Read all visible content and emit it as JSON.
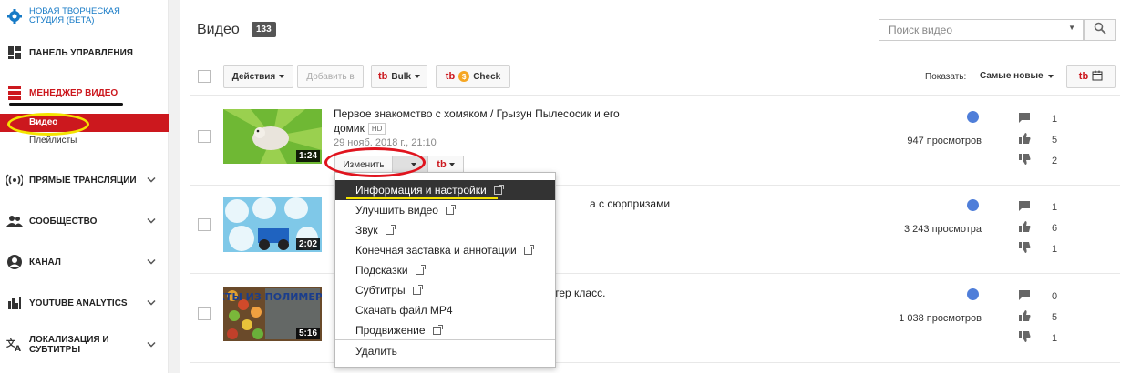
{
  "sidebar": {
    "top_link": "НОВАЯ ТВОРЧЕСКАЯ СТУДИЯ (БЕТА)",
    "dashboard": "ПАНЕЛЬ УПРАВЛЕНИЯ",
    "video_manager": "МЕНЕДЖЕР ВИДЕО",
    "videos": "Видео",
    "playlists": "Плейлисты",
    "live": "ПРЯМЫЕ ТРАНСЛЯЦИИ",
    "community": "СООБЩЕСТВО",
    "channel": "КАНАЛ",
    "analytics": "YOUTUBE ANALYTICS",
    "localization": "ЛОКАЛИЗАЦИЯ И СУБТИТРЫ"
  },
  "header": {
    "title": "Видео",
    "count": "133",
    "search_placeholder": "Поиск видео"
  },
  "toolbar": {
    "actions": "Действия",
    "add_to": "Добавить в",
    "bulk": "Bulk",
    "check": "Check",
    "tb_logo": "tb",
    "show_label": "Показать:",
    "sort_value": "Самые новые"
  },
  "videos": [
    {
      "title": "Первое знакомство с хомяком / Грызун Пылесосик и его домик",
      "hd": "HD",
      "date": "29 нояб. 2018 г., 21:10",
      "duration": "1:24",
      "views": "947 просмотров",
      "comments": "1",
      "likes": "5",
      "dislikes": "2"
    },
    {
      "title_tail": "а с сюрпризами",
      "duration": "2:02",
      "thumb_text": "",
      "views": "3 243 просмотра",
      "comments": "1",
      "likes": "6",
      "dislikes": "1"
    },
    {
      "title_tail": "тер класс.",
      "duration": "5:16",
      "thumb_text": "ФРУКТЫ ИЗ ПОЛИМЕРНОЙ ГЛИНЫ",
      "views": "1 038 просмотров",
      "comments": "0",
      "likes": "5",
      "dislikes": "1"
    }
  ],
  "edit_button": "Изменить",
  "menu": {
    "items": [
      "Информация и настройки",
      "Улучшить видео",
      "Звук",
      "Конечная заставка и аннотации",
      "Подсказки",
      "Субтитры",
      "Скачать файл MP4",
      "Продвижение",
      "Удалить"
    ]
  },
  "colors": {
    "accent_red": "#cc181e",
    "link_blue": "#167ac6",
    "annotation_yellow": "#f4e400",
    "annotation_red": "#e0141e"
  }
}
